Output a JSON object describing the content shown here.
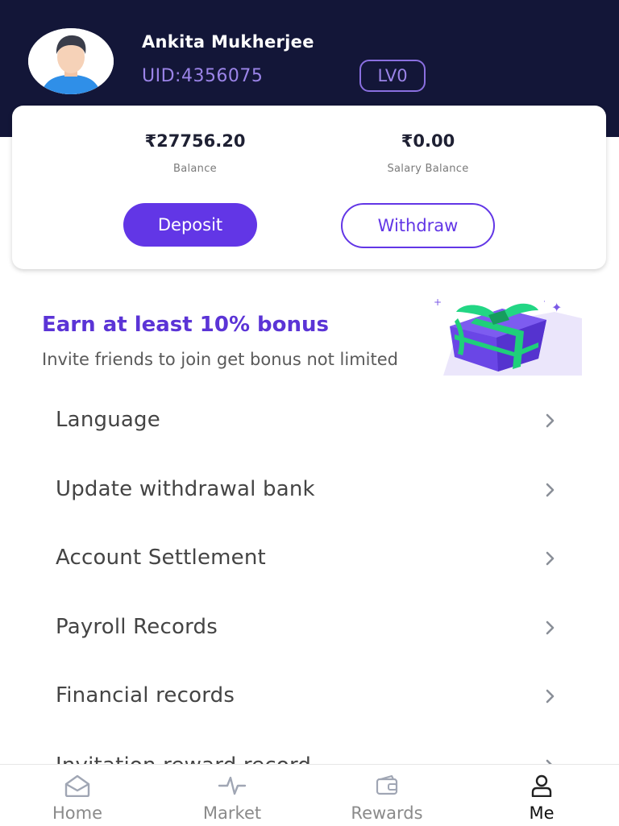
{
  "header": {
    "user_name": "Ankita Mukherjee",
    "uid": "UID:4356075",
    "level": "LV0",
    "background_color": "#131638"
  },
  "balances": {
    "balance_amount": "₹27756.20",
    "balance_label": "Balance",
    "salary_amount": "₹0.00",
    "salary_label": "Salary Balance",
    "deposit_label": "Deposit",
    "withdraw_label": "Withdraw",
    "accent_color": "#6236e6"
  },
  "promo": {
    "title": "Earn at least 10% bonus",
    "subtitle": "Invite friends to join get bonus not limited",
    "image_icon": "gift-box-icon"
  },
  "menu": {
    "items": [
      {
        "label": "Language",
        "icon": "chevron-right-icon"
      },
      {
        "label": "Update withdrawal bank",
        "icon": "chevron-right-icon"
      },
      {
        "label": "Account Settlement",
        "icon": "chevron-right-icon"
      },
      {
        "label": "Payroll Records",
        "icon": "chevron-right-icon"
      },
      {
        "label": "Financial records",
        "icon": "chevron-right-icon"
      },
      {
        "label": "Invitation reward record",
        "icon": "chevron-right-icon"
      }
    ]
  },
  "nav": {
    "items": [
      {
        "label": "Home",
        "icon": "home-icon",
        "active": false
      },
      {
        "label": "Market",
        "icon": "pulse-icon",
        "active": false
      },
      {
        "label": "Rewards",
        "icon": "wallet-icon",
        "active": false
      },
      {
        "label": "Me",
        "icon": "person-icon",
        "active": true
      }
    ]
  }
}
